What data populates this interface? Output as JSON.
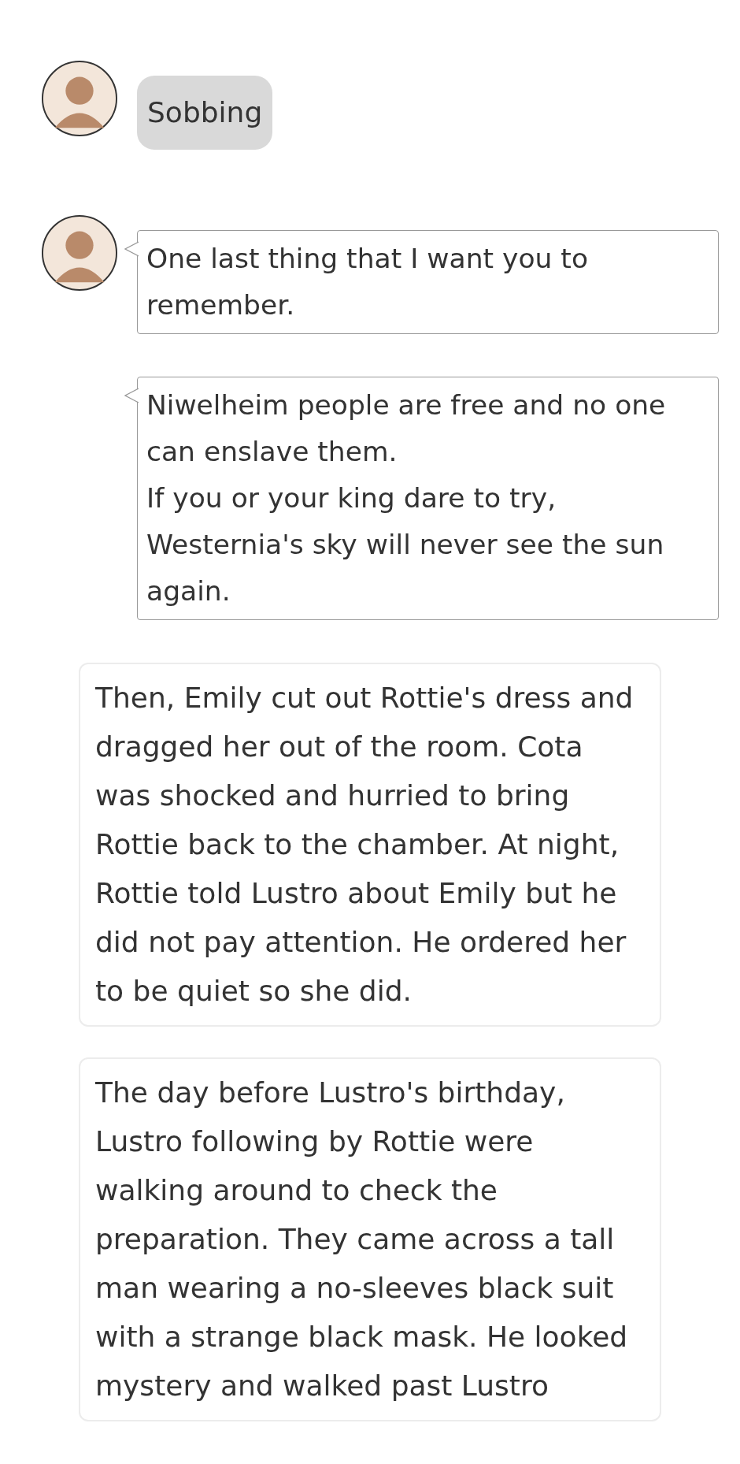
{
  "messages": [
    {
      "kind": "thought",
      "avatar": true,
      "text": "Sobbing"
    },
    {
      "kind": "speech",
      "avatar": true,
      "text": "One last thing that I want you to remember."
    },
    {
      "kind": "speech",
      "avatar": false,
      "text": "Niwelheim people are free and no one can enslave them.\nIf you or your king dare to try, Westernia's sky will never see the sun again."
    },
    {
      "kind": "narration",
      "text": "Then, Emily cut out Rottie's dress and dragged her out of the room. Cota was shocked and hurried to bring Rottie back to the chamber. At night, Rottie told Lustro about Emily but he did not pay attention. He ordered her to be quiet so she did."
    },
    {
      "kind": "narration",
      "text": "The day before Lustro's birthday, Lustro following by Rottie were walking around to check the preparation. They came across a tall man wearing a no-sleeves black suit with a strange black mask. He looked mystery and walked past Lustro"
    }
  ]
}
